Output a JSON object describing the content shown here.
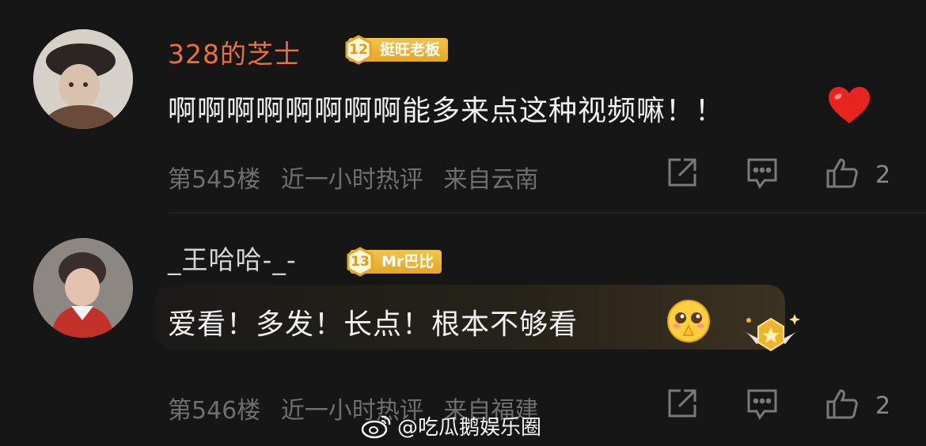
{
  "comments": [
    {
      "username": "328的芝士",
      "badge_level": "12",
      "badge_label": "挺旺老板",
      "text": "啊啊啊啊啊啊啊啊能多来点这种视频嘛！！",
      "floor": "第545楼",
      "time": "近一小时热评",
      "location": "来自云南",
      "likes": "2",
      "icons": [
        "share-icon",
        "reply-icon",
        "like-icon",
        "heart-icon"
      ]
    },
    {
      "username": "_王哈哈-_-",
      "badge_level": "13",
      "badge_label": "Mr巴比",
      "text": "爱看！多发！长点！根本不够看",
      "floor": "第546楼",
      "time": "近一小时热评",
      "location": "来自福建",
      "likes": "2",
      "icons": [
        "share-icon",
        "reply-icon",
        "like-icon",
        "pleading-emoji-icon",
        "medal-icon"
      ]
    }
  ],
  "watermark": "@吃瓜鹅娱乐圈",
  "colors": {
    "background": "#161616",
    "username_highlight": "#e8723a",
    "badge": "#f2c44a",
    "meta": "#6f6f6f"
  }
}
